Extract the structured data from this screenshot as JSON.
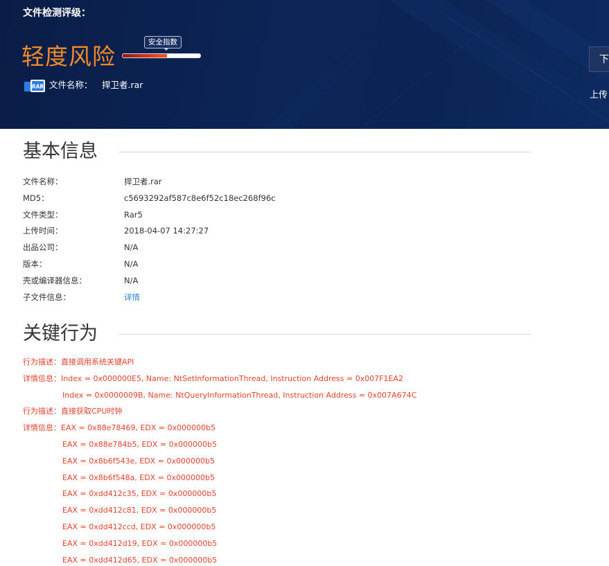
{
  "header": {
    "label": "文件检测评级：",
    "risk_level": "轻度风险",
    "safety_badge": "安全指数",
    "safety_index_fraction": 0.57,
    "file_icon_text": "RAR",
    "file_name_label": "文件名称：",
    "file_name_value": "捍卫者.rar",
    "download_label": "下",
    "upload_label": "上传"
  },
  "basic_info": {
    "title": "基本信息",
    "rows": [
      {
        "key": "文件名称：",
        "value": "捍卫者.rar"
      },
      {
        "key": "MD5：",
        "value": "c5693292af587c8e6f52c18ec268f96c"
      },
      {
        "key": "文件类型：",
        "value": "Rar5"
      },
      {
        "key": "上传时间：",
        "value": "2018-04-07 14:27:27"
      },
      {
        "key": "出品公司：",
        "value": "N/A"
      },
      {
        "key": "版本：",
        "value": "N/A"
      },
      {
        "key": "壳或编译器信息：",
        "value": "N/A"
      },
      {
        "key": "子文件信息：",
        "value": "详情"
      }
    ]
  },
  "key_behavior": {
    "title": "关键行为",
    "lines": [
      "行为描述：直接调用系统关键API",
      "详情信息：Index = 0x000000E5, Name: NtSetInformationThread, Instruction Address = 0x007F1EA2",
      "Index = 0x0000009B, Name: NtQueryInformationThread, Instruction Address = 0x007A674C",
      "行为描述：直接获取CPU时钟",
      "详情信息：EAX = 0x88e78469, EDX = 0x000000b5",
      "EAX = 0x88e784b5, EDX = 0x000000b5",
      "EAX = 0x8b6f543e, EDX = 0x000000b5",
      "EAX = 0x8b6f548a, EDX = 0x000000b5",
      "EAX = 0xdd412c35, EDX = 0x000000b5",
      "EAX = 0xdd412c81, EDX = 0x000000b5",
      "EAX = 0xdd412ccd, EDX = 0x000000b5",
      "EAX = 0xdd412d19, EDX = 0x000000b5",
      "EAX = 0xdd412d65, EDX = 0x000000b5"
    ]
  },
  "colors": {
    "header_bg": "#0c2556",
    "risk_orange": "#f58b25",
    "behavior_red": "#e5442e",
    "link_blue": "#2a7dd1"
  }
}
